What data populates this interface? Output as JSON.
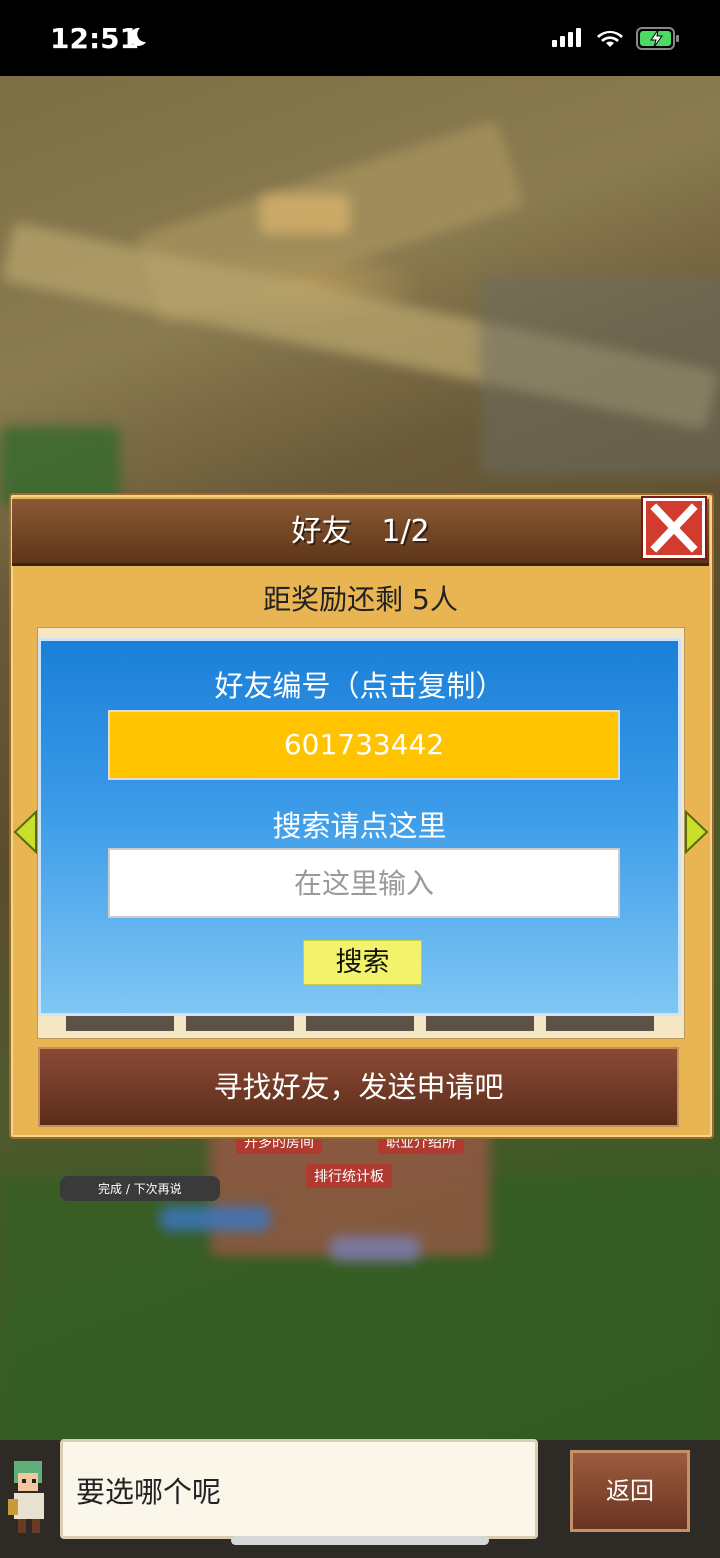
{
  "status_bar": {
    "time": "12:51"
  },
  "town": {
    "labels": [
      "开多的房间",
      "职业介绍所",
      "排行统计板",
      "完成 / 下次再说"
    ]
  },
  "dialog": {
    "title": "好友　1/2",
    "reward_text": "距奖励还剩 5人",
    "find_button": "寻找好友，发送申请吧"
  },
  "popup": {
    "id_label": "好友编号（点击复制）",
    "friend_id": "601733442",
    "search_label": "搜索请点这里",
    "search_placeholder": "在这里输入",
    "search_button": "搜索"
  },
  "chat": {
    "prompt": "要选哪个呢",
    "back_button": "返回"
  },
  "colors": {
    "header_brown": "#6e4024",
    "dialog_gold": "#e9b553",
    "popup_blue": "#2b8fe2",
    "id_yellow": "#ffc300",
    "search_button_yellow": "#f2f36a",
    "close_red": "#d23c2e"
  }
}
